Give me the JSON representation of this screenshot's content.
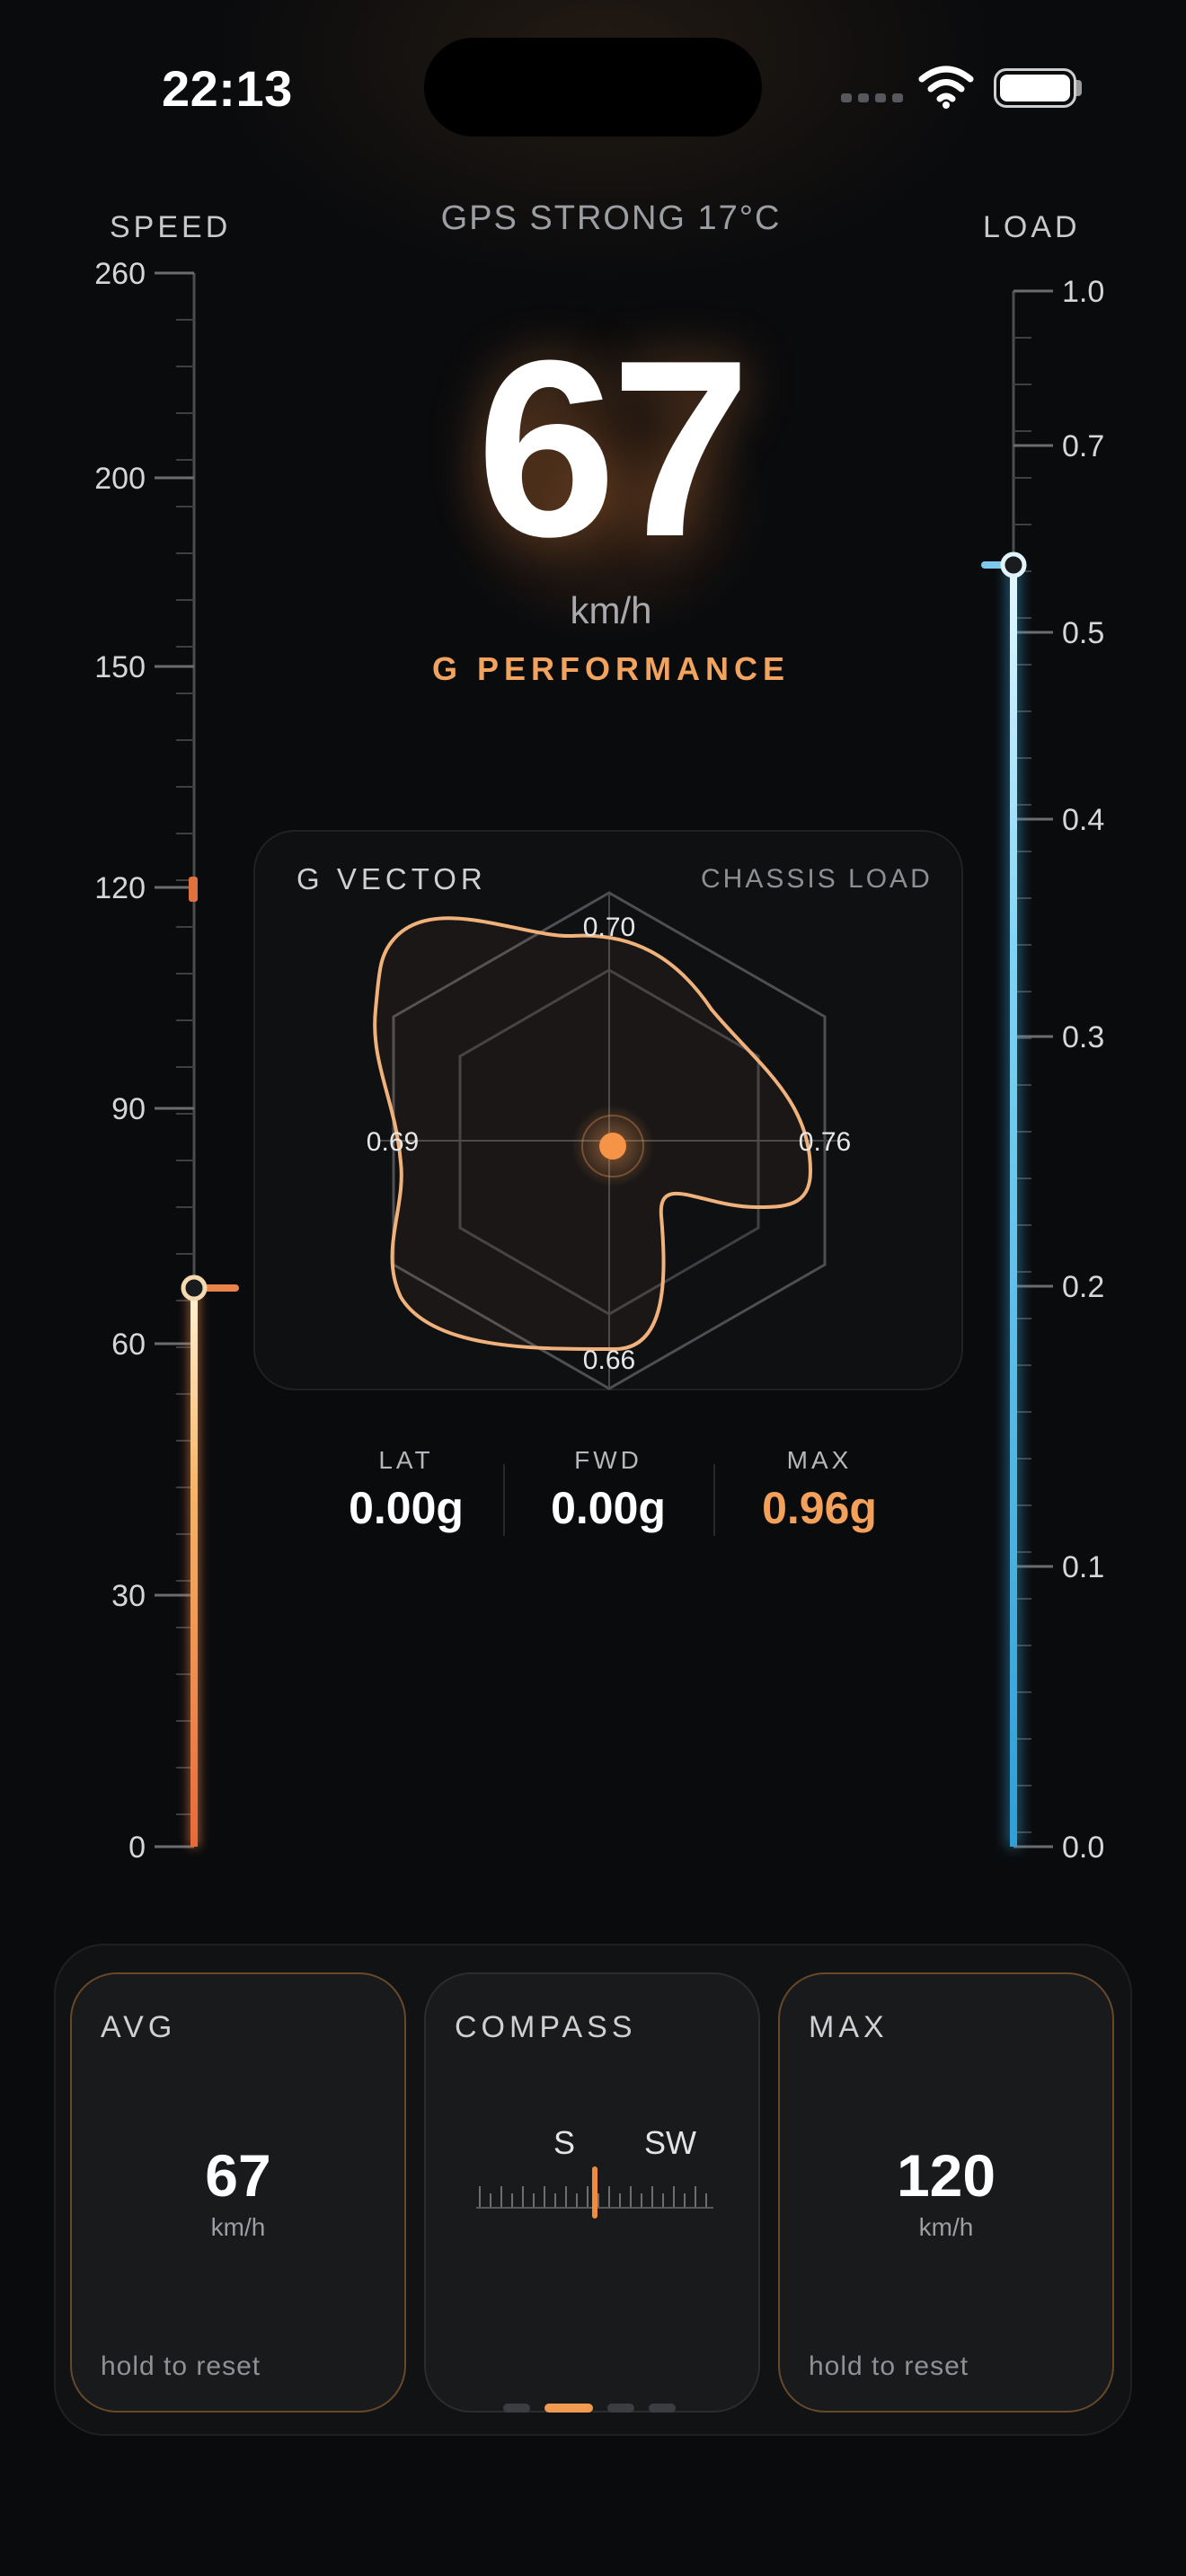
{
  "status_bar": {
    "time": "22:13"
  },
  "header": {
    "speed_label": "SPEED",
    "load_label": "LOAD",
    "status_text": "GPS STRONG  17°C"
  },
  "main": {
    "speed_value": "67",
    "speed_unit": "km/h",
    "mode_label": "G PERFORMANCE"
  },
  "speed_scale": {
    "ticks": [
      "260",
      "200",
      "150",
      "120",
      "90",
      "60",
      "30",
      "0"
    ],
    "current": 67,
    "marker": 120,
    "accent": "#f08a4b"
  },
  "load_scale": {
    "ticks": [
      "1.0",
      "0.7",
      "0.5",
      "0.4",
      "0.3",
      "0.2",
      "0.1",
      "0.0"
    ],
    "current": 0.54,
    "accent": "#3fb6e8"
  },
  "g_panel": {
    "title": "G VECTOR",
    "subtitle": "CHASSIS LOAD",
    "labels": {
      "top": "0.70",
      "left": "0.69",
      "right": "0.76",
      "bottom": "0.66"
    },
    "accent": "#f0a060"
  },
  "stats": [
    {
      "label": "LAT",
      "value": "0.00g"
    },
    {
      "label": "FWD",
      "value": "0.00g"
    },
    {
      "label": "MAX",
      "value": "0.96g"
    }
  ],
  "cards": {
    "avg": {
      "title": "AVG",
      "value": "67",
      "unit": "km/h",
      "hint": "hold to reset"
    },
    "compass": {
      "title": "COMPASS",
      "dir1": "S",
      "dir2": "SW"
    },
    "max": {
      "title": "MAX",
      "value": "120",
      "unit": "km/h",
      "hint": "hold to reset"
    }
  },
  "pager": {
    "count": 4,
    "active": 1
  },
  "icons": {
    "wifi": "wifi-icon",
    "battery": "battery-icon"
  }
}
